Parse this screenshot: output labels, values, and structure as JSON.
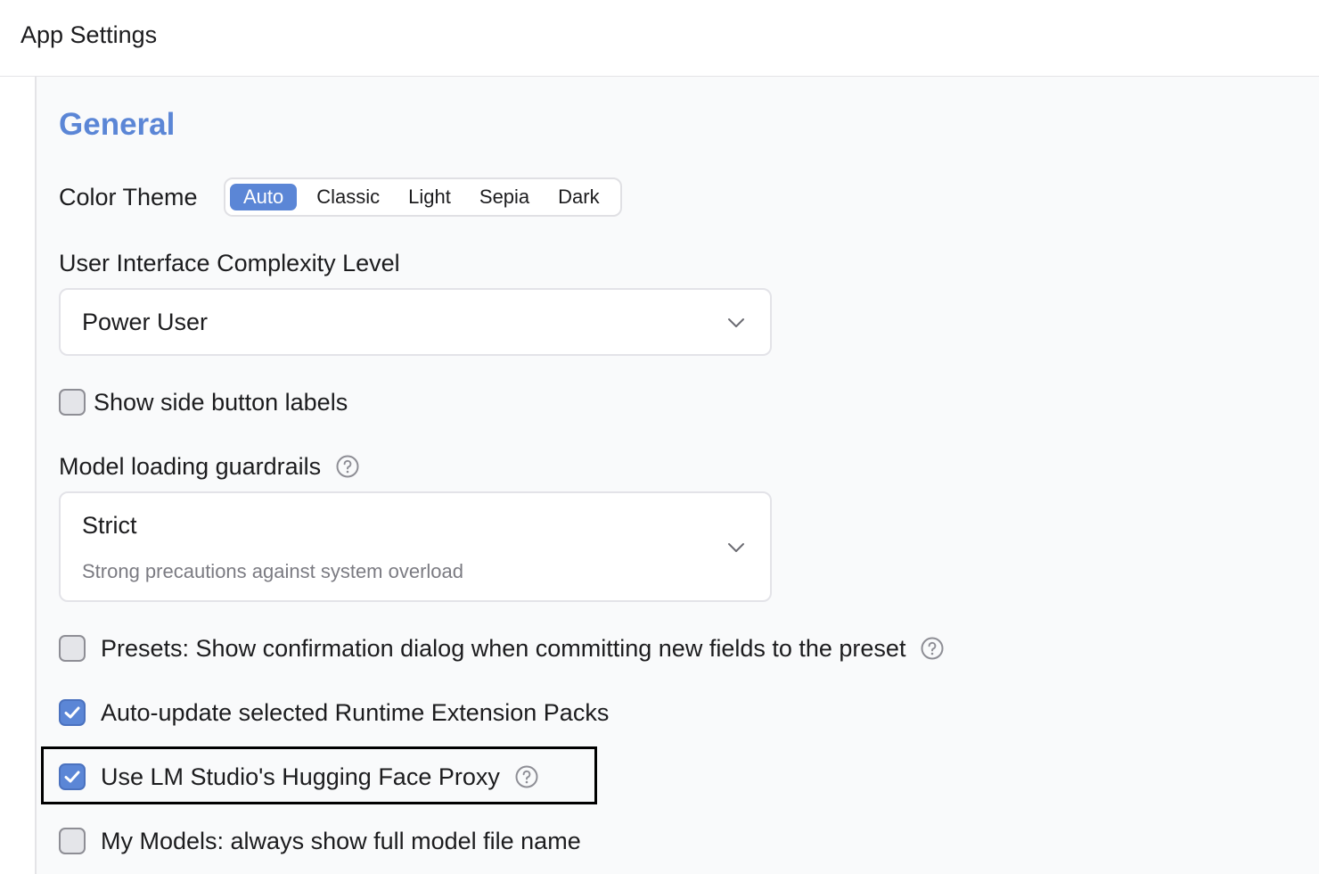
{
  "app": {
    "title": "App Settings"
  },
  "general": {
    "title": "General",
    "color_theme": {
      "label": "Color Theme",
      "options": [
        "Auto",
        "Classic",
        "Light",
        "Sepia",
        "Dark"
      ],
      "selected": "Auto"
    },
    "complexity": {
      "label": "User Interface Complexity Level",
      "value": "Power User"
    },
    "show_side_labels": {
      "label": "Show side button labels",
      "checked": false
    },
    "guardrails": {
      "label": "Model loading guardrails",
      "value": "Strict",
      "description": "Strong precautions against system overload"
    },
    "presets_confirm": {
      "label": "Presets: Show confirmation dialog when committing new fields to the preset",
      "checked": false
    },
    "auto_update": {
      "label": "Auto-update selected Runtime Extension Packs",
      "checked": true
    },
    "hf_proxy": {
      "label": "Use LM Studio's Hugging Face Proxy",
      "checked": true
    },
    "full_model_name": {
      "label": "My Models: always show full model file name",
      "checked": false
    }
  },
  "icons": {
    "help": "question-circle-icon",
    "check": "check-icon",
    "chevron": "chevron-down-icon"
  },
  "colors": {
    "accent": "#5b86d6",
    "background": "#f9fafb",
    "highlight_border": "#000000"
  }
}
